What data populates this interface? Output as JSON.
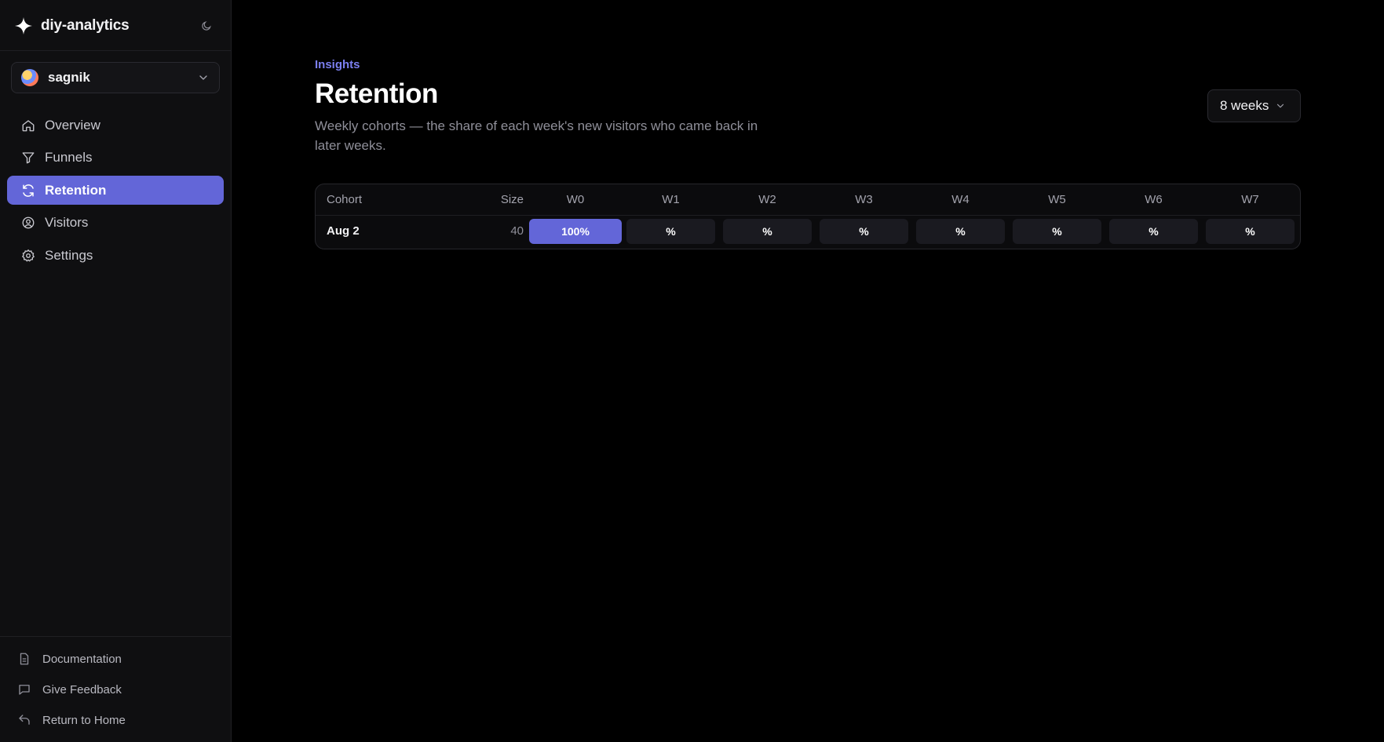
{
  "app": {
    "name": "diy-analytics"
  },
  "workspace": {
    "name": "sagnik"
  },
  "nav": [
    {
      "label": "Overview",
      "icon": "home-icon"
    },
    {
      "label": "Funnels",
      "icon": "filter-icon"
    },
    {
      "label": "Retention",
      "icon": "refresh-icon",
      "active": true
    },
    {
      "label": "Visitors",
      "icon": "user-circle-icon"
    },
    {
      "label": "Settings",
      "icon": "gear-icon"
    }
  ],
  "footer": {
    "documentation": "Documentation",
    "feedback": "Give Feedback",
    "home": "Return to Home"
  },
  "page": {
    "breadcrumb": "Insights",
    "title": "Retention",
    "description": "Weekly cohorts — the share of each week's new visitors who came back in later weeks.",
    "range": "8 weeks"
  },
  "table": {
    "headers": {
      "cohort": "Cohort",
      "size": "Size",
      "weeks": [
        "W0",
        "W1",
        "W2",
        "W3",
        "W4",
        "W5",
        "W6",
        "W7"
      ]
    },
    "rows": [
      {
        "cohort": "Aug 2",
        "size": "40",
        "cells": [
          "100%",
          "%",
          "%",
          "%",
          "%",
          "%",
          "%",
          "%"
        ]
      }
    ]
  },
  "colors": {
    "accent": "#6366d8",
    "background": "#000000",
    "sidebar": "#0f0f11",
    "breadcrumb": "#7b7ff0"
  }
}
